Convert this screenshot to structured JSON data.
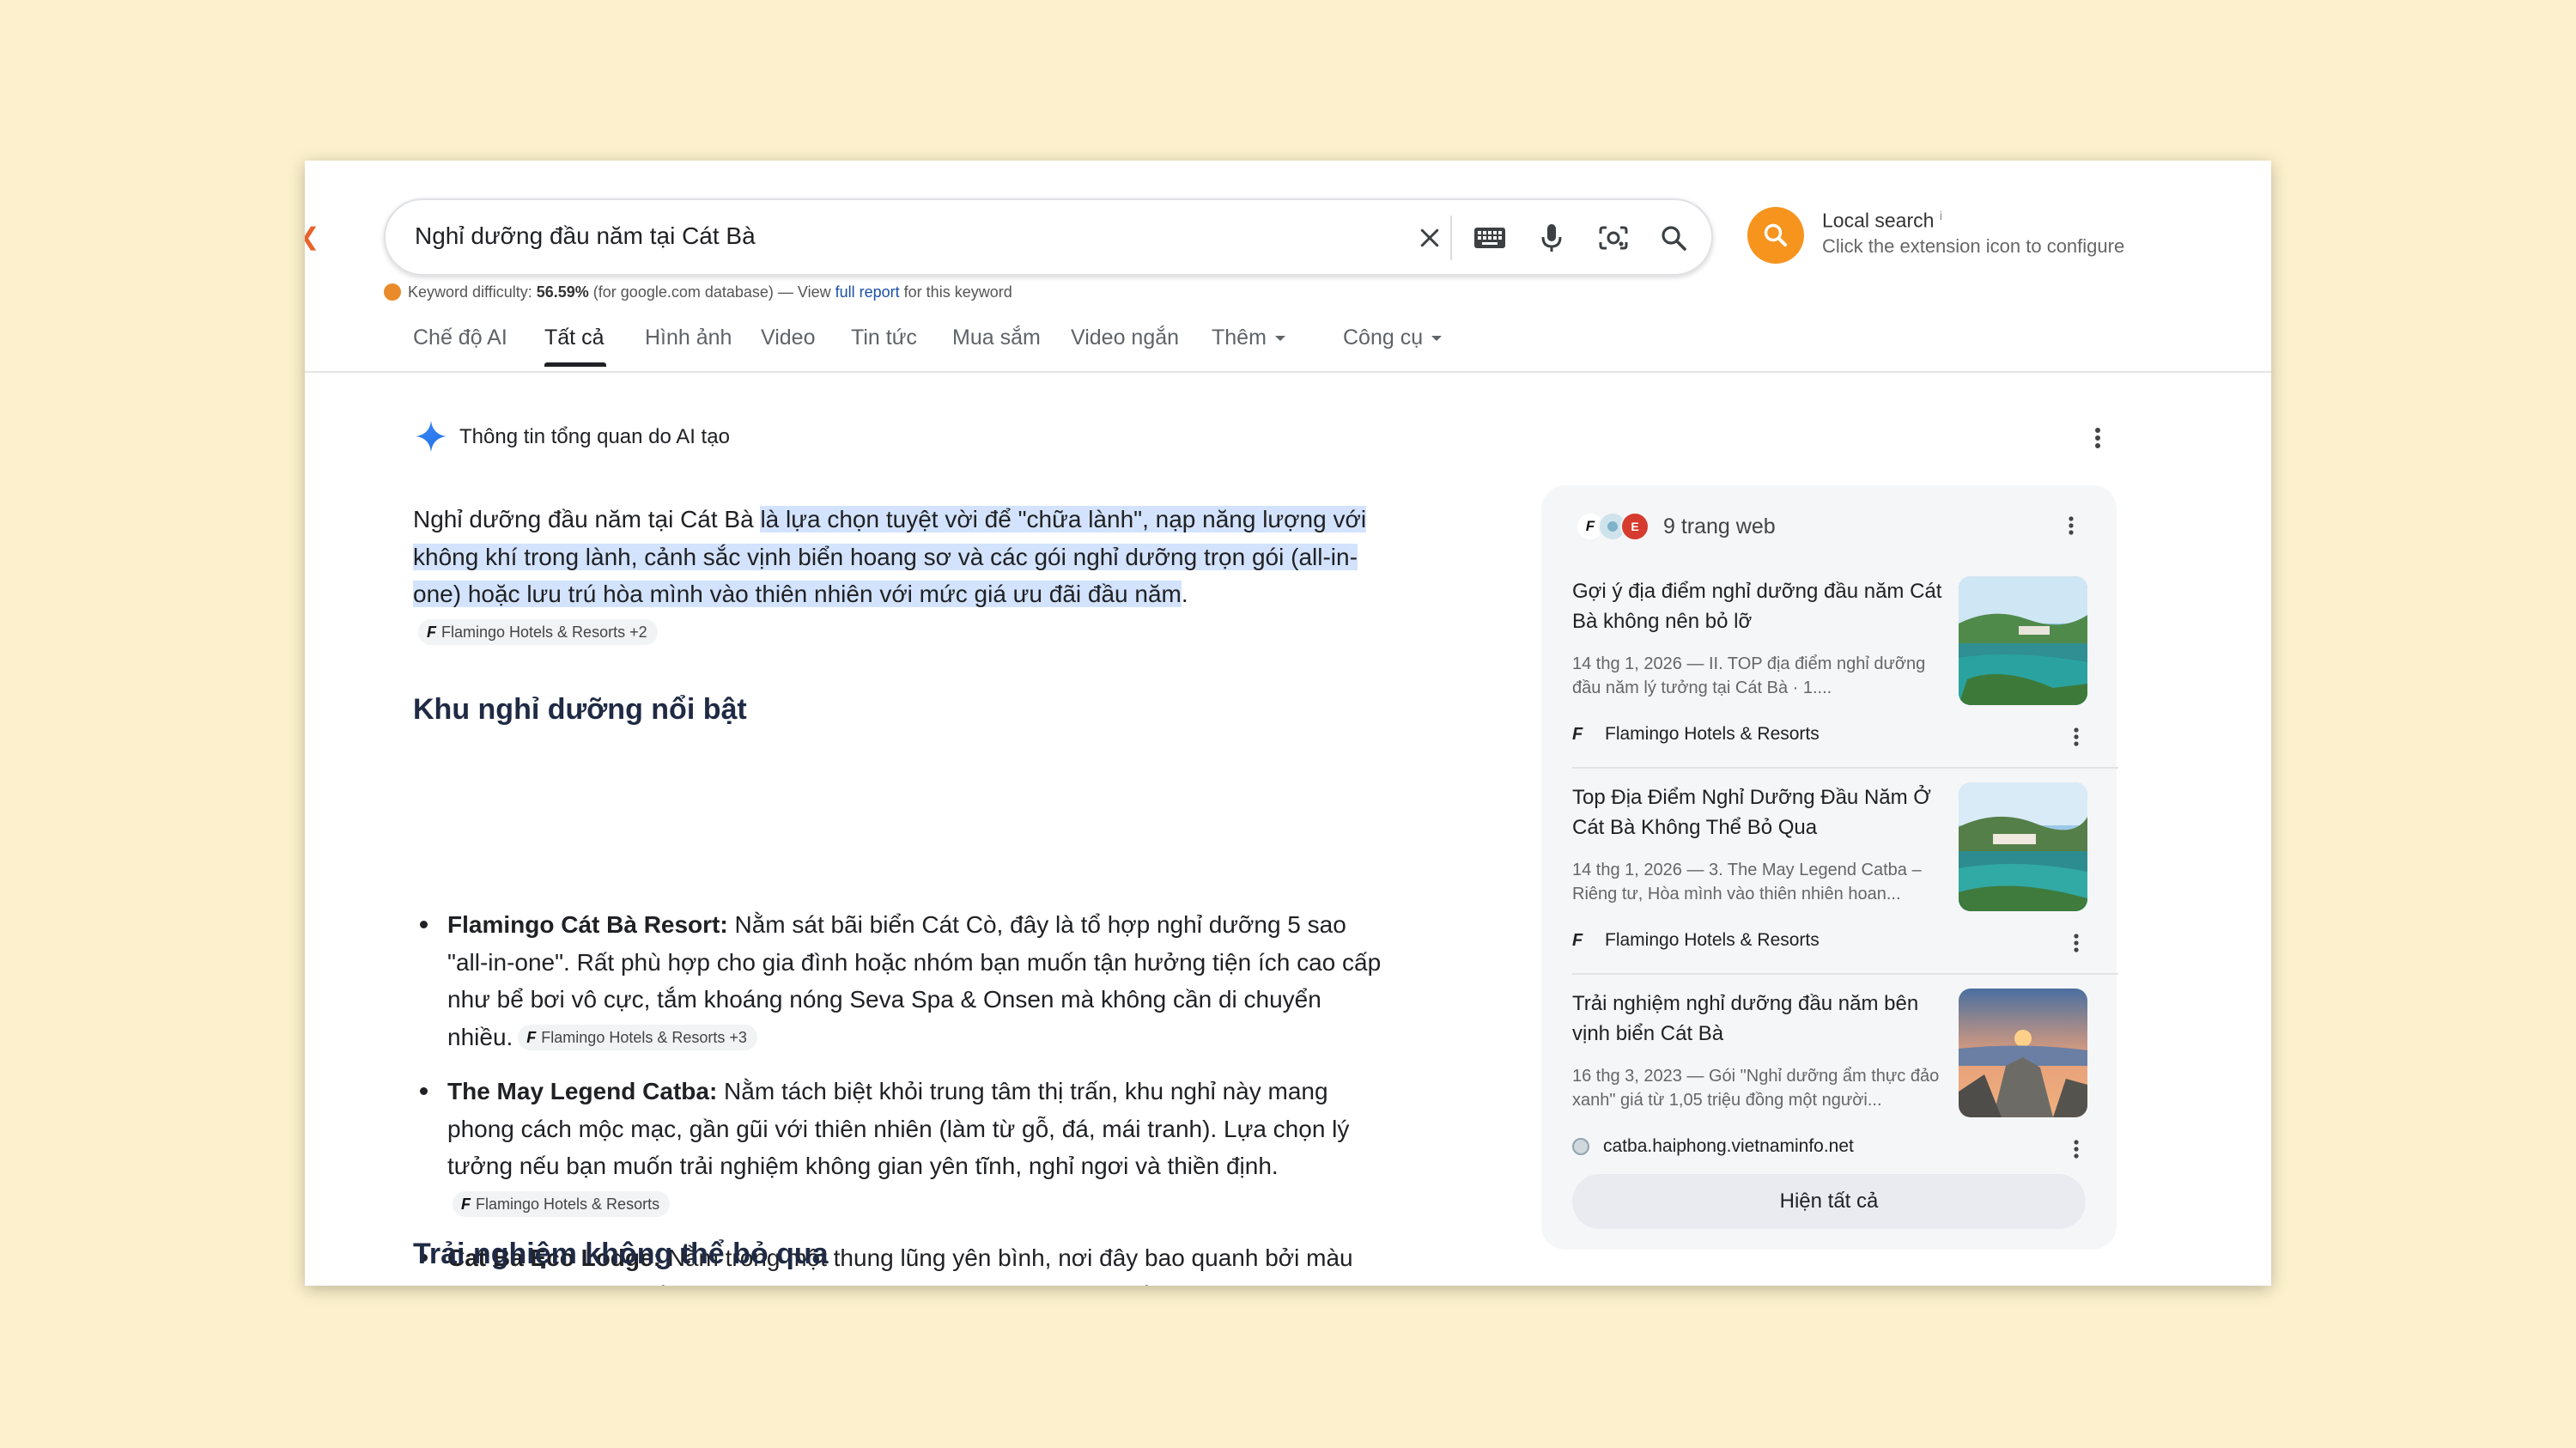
{
  "search": {
    "query": "Nghỉ dưỡng đầu năm tại Cát Bà"
  },
  "extension": {
    "title": "Local search",
    "info_mark": "i",
    "subtitle": "Click the extension icon to configure"
  },
  "keyword": {
    "prefix": "Keyword difficulty: ",
    "value": "56.59%",
    "middle": " (for google.com database) — View ",
    "link": "full report",
    "suffix": " for this keyword"
  },
  "tabs": [
    {
      "label": "Chế độ AI"
    },
    {
      "label": "Tất cả",
      "active": true
    },
    {
      "label": "Hình ảnh"
    },
    {
      "label": "Video"
    },
    {
      "label": "Tin tức"
    },
    {
      "label": "Mua sắm"
    },
    {
      "label": "Video ngắn"
    },
    {
      "label": "Thêm"
    },
    {
      "label": "Công cụ"
    }
  ],
  "ai_overview": {
    "title": "Thông tin tổng quan do AI tạo",
    "intro_plain": "Nghỉ dưỡng đầu năm tại Cát Bà ",
    "intro_highlight": "là lựa chọn tuyệt vời để \"chữa lành\", nạp năng lượng với không khí trong lành, cảnh sắc vịnh biển hoang sơ và các gói nghỉ dưỡng trọn gói (all-in-one) hoặc lưu trú hòa mình vào thiên nhiên với mức giá ưu đãi đầu năm",
    "intro_end": ".",
    "intro_chip": "Flamingo Hotels & Resorts +2",
    "section1": "Khu nghỉ dưỡng nổi bật",
    "section2": "Trải nghiệm không thể bỏ qua",
    "bullets": [
      {
        "name": "Flamingo Cát Bà Resort:",
        "text": " Nằm sát bãi biển Cát Cò, đây là tổ hợp nghỉ dưỡng 5 sao \"all-in-one\". Rất phù hợp cho gia đình hoặc nhóm bạn muốn tận hưởng tiện ích cao cấp như bể bơi vô cực, tắm khoáng nóng Seva Spa & Onsen mà không cần di chuyển nhiều.",
        "chip": "Flamingo Hotels & Resorts +3"
      },
      {
        "name": "The May Legend Catba:",
        "text": " Nằm tách biệt khỏi trung tâm thị trấn, khu nghỉ này mang phong cách mộc mạc, gần gũi với thiên nhiên (làm từ gỗ, đá, mái tranh). Lựa chọn lý tưởng nếu bạn muốn trải nghiệm không gian yên tĩnh, nghỉ ngơi và thiền định.",
        "chip": "Flamingo Hotels & Resorts"
      },
      {
        "name": "Cat Ba Eco Lodge:",
        "text": " Nằm trong một thung lũng yên bình, nơi đây bao quanh bởi màu xanh của Vườn Quốc Gia Cát Bà. Tuyệt vời cho các gia đình muốn đạp xe, đi dạo và khám phá hệ sinh thái.",
        "chip": ""
      }
    ]
  },
  "panel": {
    "count_label": "9 trang web",
    "show_all": "Hiện tất cả",
    "sources": [
      {
        "title": "Gợi ý địa điểm nghỉ dưỡng đầu năm Cát Bà không nên bỏ lỡ",
        "snippet": "14 thg 1, 2026 — II. TOP địa điểm nghỉ dưỡng đầu năm lý tưởng tại Cát Bà · 1....",
        "site": "Flamingo Hotels & Resorts",
        "site_type": "flamingo"
      },
      {
        "title": "Top Địa Điểm Nghỉ Dưỡng Đầu Năm Ở Cát Bà Không Thể Bỏ Qua",
        "snippet": "14 thg 1, 2026 — 3. The May Legend Catba – Riêng tư, Hòa mình vào thiên nhiên hoan...",
        "site": "Flamingo Hotels & Resorts",
        "site_type": "flamingo"
      },
      {
        "title": "Trải nghiệm nghỉ dưỡng đầu năm bên vịnh biển Cát Bà",
        "snippet": "16 thg 3, 2023 — Gói \"Nghỉ dưỡng ẩm thực đảo xanh\" giá từ 1,05 triệu đồng một người...",
        "site": "catba.haiphong.vietnaminfo.net",
        "site_type": "globe"
      }
    ]
  },
  "icons": {
    "clear": "close-icon",
    "keyboard": "keyboard-icon",
    "voice": "microphone-icon",
    "lens": "camera-lens-icon",
    "search": "search-icon",
    "ai": "sparkle-icon",
    "more": "more-vertical-icon"
  },
  "colors": {
    "background": "#fcf1cc",
    "highlight": "#d3e3fd",
    "extension": "#f6941e",
    "heading": "#1f2a44"
  }
}
